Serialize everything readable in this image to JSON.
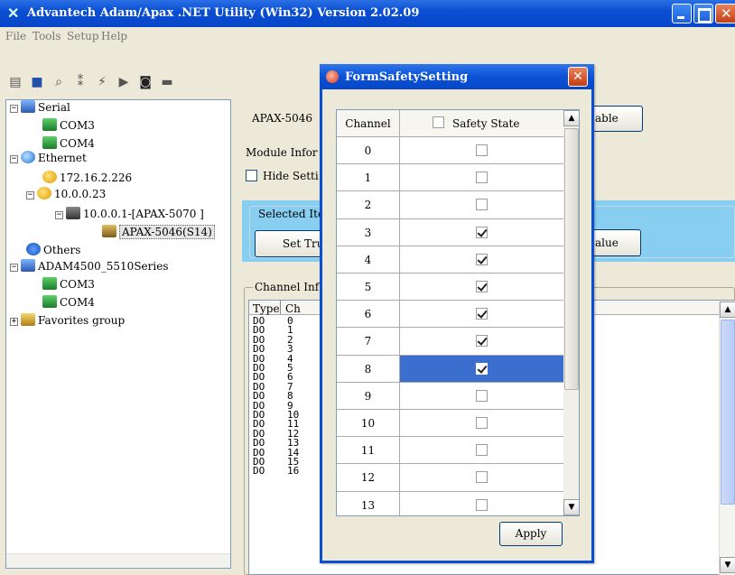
{
  "window": {
    "title": "Advantech Adam/Apax .NET Utility (Win32) Version 2.02.09"
  },
  "menu": [
    "File",
    "Tools",
    "Setup",
    "Help"
  ],
  "toolbar": [
    "open-icon",
    "save-icon",
    "search-icon",
    "network-icon",
    "flash-icon",
    "play-icon",
    "camera-icon",
    "stop-icon"
  ],
  "tree": {
    "serial": "Serial",
    "com3": "COM3",
    "com4": "COM4",
    "ethernet": "Ethernet",
    "ip1": "172.16.2.226",
    "ip2": "10.0.0.23",
    "node": "10.0.0.1-[APAX-5070 ]",
    "module": "APAX-5046(S14)",
    "others": "Others",
    "adam": "ADAM4500_5510Series",
    "com3b": "COM3",
    "com4b": "COM4",
    "favorites": "Favorites group"
  },
  "right": {
    "module_name": "APAX-5046",
    "enable_btn": "able",
    "module_info": "Module Infor",
    "hide_settings": "Hide Setti",
    "selected_items": "Selected Ite",
    "set_true": "Set Tru",
    "value_btn": "alue",
    "channel_info": "Channel Inf",
    "list_headers": [
      "Type",
      "Ch"
    ],
    "list_rows": [
      [
        "DO",
        "0"
      ],
      [
        "DO",
        "1"
      ],
      [
        "DO",
        "2"
      ],
      [
        "DO",
        "3"
      ],
      [
        "DO",
        "4"
      ],
      [
        "DO",
        "5"
      ],
      [
        "DO",
        "6"
      ],
      [
        "DO",
        "7"
      ],
      [
        "DO",
        "8"
      ],
      [
        "DO",
        "9"
      ],
      [
        "DO",
        "10"
      ],
      [
        "DO",
        "11"
      ],
      [
        "DO",
        "12"
      ],
      [
        "DO",
        "13"
      ],
      [
        "DO",
        "14"
      ],
      [
        "DO",
        "15"
      ],
      [
        "DO",
        "16"
      ]
    ]
  },
  "dialog": {
    "title": "FormSafetySetting",
    "col_channel": "Channel",
    "col_safety": "Safety State",
    "rows": [
      {
        "channel": "0",
        "checked": false
      },
      {
        "channel": "1",
        "checked": false
      },
      {
        "channel": "2",
        "checked": false
      },
      {
        "channel": "3",
        "checked": true
      },
      {
        "channel": "4",
        "checked": true
      },
      {
        "channel": "5",
        "checked": true
      },
      {
        "channel": "6",
        "checked": true
      },
      {
        "channel": "7",
        "checked": true
      },
      {
        "channel": "8",
        "checked": true,
        "selected": true
      },
      {
        "channel": "9",
        "checked": false
      },
      {
        "channel": "10",
        "checked": false
      },
      {
        "channel": "11",
        "checked": false
      },
      {
        "channel": "12",
        "checked": false
      },
      {
        "channel": "13",
        "checked": false
      }
    ],
    "apply": "Apply"
  }
}
